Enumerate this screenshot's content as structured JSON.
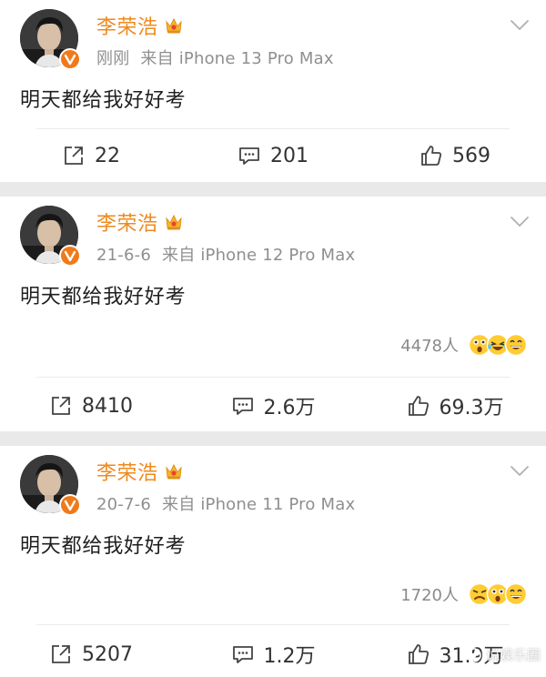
{
  "accent_color": "#ee8a1f",
  "watermark": {
    "text": "说娱乐圈"
  },
  "posts": [
    {
      "author": "李荣浩",
      "time": "刚刚",
      "source": "来自 iPhone 13 Pro Max",
      "content": "明天都给我好好考",
      "reactions": null,
      "actions": {
        "repost": "22",
        "comment": "201",
        "like": "569"
      }
    },
    {
      "author": "李荣浩",
      "time": "21-6-6",
      "source": "来自 iPhone 12 Pro Max",
      "content": "明天都给我好好考",
      "reactions": {
        "count": "4478人",
        "emojis": [
          "surprised-emoji-icon",
          "laughing-tears-emoji-icon",
          "grin-emoji-icon"
        ]
      },
      "actions": {
        "repost": "8410",
        "comment": "2.6万",
        "like": "69.3万"
      }
    },
    {
      "author": "李荣浩",
      "time": "20-7-6",
      "source": "来自 iPhone 11 Pro Max",
      "content": "明天都给我好好考",
      "reactions": {
        "count": "1720人",
        "emojis": [
          "annoyed-emoji-icon",
          "surprised-emoji-icon",
          "grin-emoji-icon"
        ]
      },
      "actions": {
        "repost": "5207",
        "comment": "1.2万",
        "like": "31.9万"
      }
    }
  ]
}
